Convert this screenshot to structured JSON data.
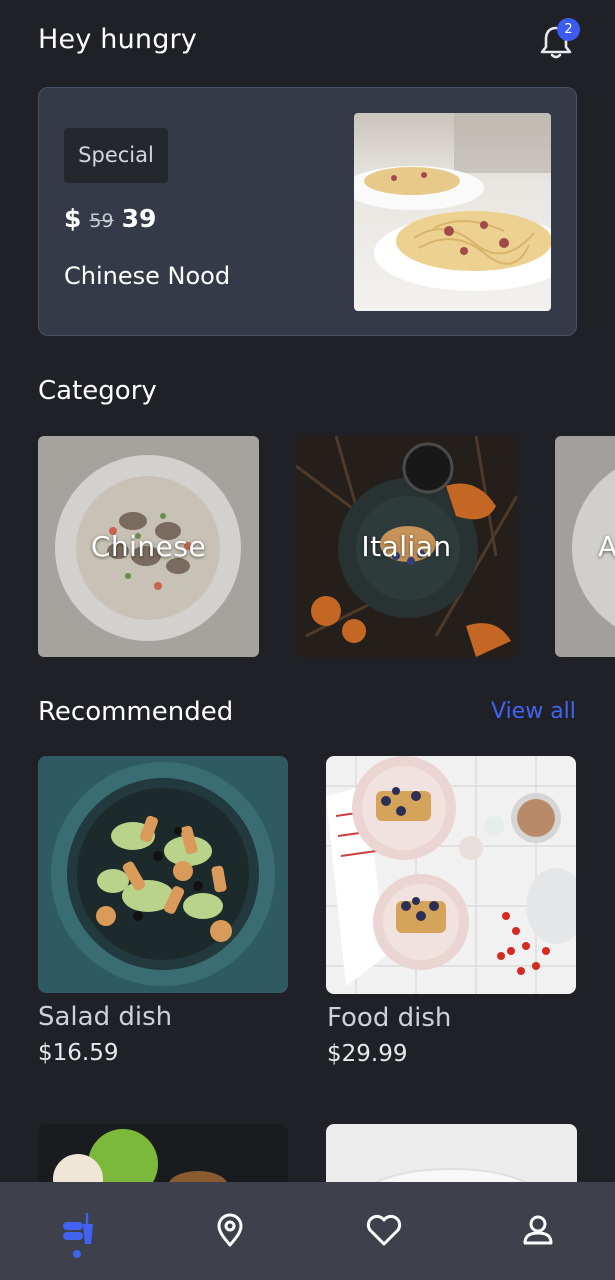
{
  "header": {
    "greeting": "Hey hungry",
    "notification_count": "2"
  },
  "special": {
    "tag": "Special",
    "currency": "$",
    "old_price": "59",
    "new_price": "39",
    "name": "Chinese Nood"
  },
  "category": {
    "title": "Category",
    "items": [
      {
        "label": "Chinese"
      },
      {
        "label": "Italian"
      },
      {
        "label": "A"
      }
    ]
  },
  "recommended": {
    "title": "Recommended",
    "view_all": "View all",
    "items": [
      {
        "name": "Salad dish",
        "price": "$16.59"
      },
      {
        "name": "Food dish",
        "price": "$29.99"
      }
    ]
  },
  "nav": {
    "items": [
      {
        "icon": "food-icon",
        "active": true
      },
      {
        "icon": "location-pin-icon",
        "active": false
      },
      {
        "icon": "heart-icon",
        "active": false
      },
      {
        "icon": "user-icon",
        "active": false
      }
    ],
    "accent": "#4163f2"
  },
  "colors": {
    "background": "#202126",
    "card": "#353a48",
    "accent": "#3b5bf0"
  }
}
